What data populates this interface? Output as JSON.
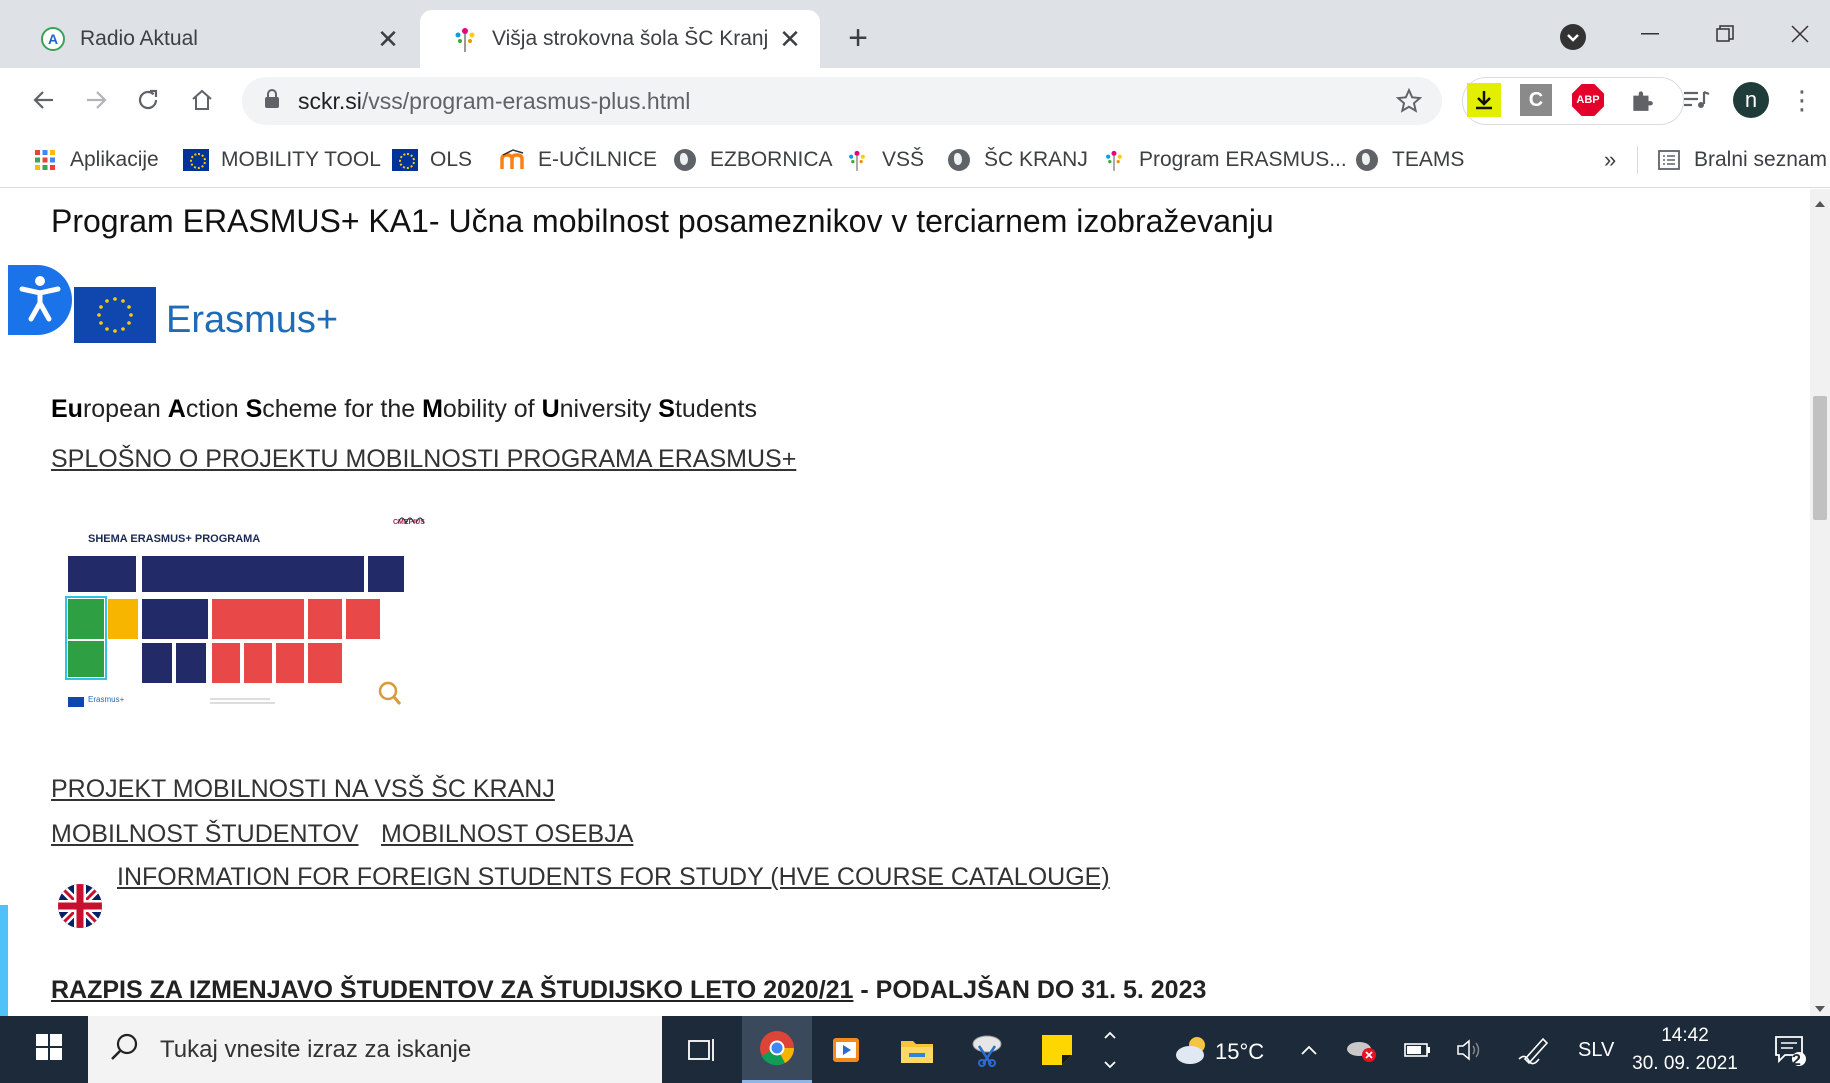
{
  "browser": {
    "tabs": [
      {
        "title": "Radio Aktual",
        "favicon": "radio-aktual-icon",
        "active": false
      },
      {
        "title": "Višja strokovna šola ŠC Kranj - ER",
        "favicon": "sckr-icon",
        "active": true
      }
    ],
    "new_tab_label": "+",
    "address_bar": {
      "domain": "sckr.si",
      "path": "/vss/program-erasmus-plus.html"
    },
    "profile_initial": "n",
    "extensions": [
      "download-icon",
      "c-extension-icon",
      "adblock-icon",
      "puzzle-icon",
      "media-control-icon"
    ],
    "adblock_label": "ABP",
    "c_ext_label": "C"
  },
  "bookmarks": {
    "items": [
      {
        "label": "Aplikacije",
        "icon": "apps-grid-icon"
      },
      {
        "label": "MOBILITY TOOL",
        "icon": "eu-flag-icon"
      },
      {
        "label": "OLS",
        "icon": "eu-flag-icon"
      },
      {
        "label": "E-UČILNICE",
        "icon": "moodle-icon"
      },
      {
        "label": "EZBORNICA",
        "icon": "globe-icon"
      },
      {
        "label": "VSŠ",
        "icon": "sckr-icon"
      },
      {
        "label": "ŠC KRANJ",
        "icon": "globe-icon"
      },
      {
        "label": "Program ERASMUS...",
        "icon": "sckr-icon"
      },
      {
        "label": "TEAMS",
        "icon": "globe-icon"
      }
    ],
    "overflow_label": "»",
    "reading_list_label": "Bralni seznam"
  },
  "page": {
    "title": "Program ERASMUS+ KA1- Učna mobilnost posameznikov v terciarnem izobraževanju",
    "logo_text": "Erasmus+",
    "acronym_parts": [
      {
        "bold": "Eu",
        "rest": "ropean "
      },
      {
        "bold": "A",
        "rest": "ction "
      },
      {
        "bold": "S",
        "rest": "cheme for the "
      },
      {
        "bold": "M",
        "rest": "obility of "
      },
      {
        "bold": "U",
        "rest": "niversity "
      },
      {
        "bold": "S",
        "rest": "tudents"
      }
    ],
    "links": {
      "general": "SPLOŠNO O PROJEKTU MOBILNOSTI PROGRAMA ERASMUS+",
      "project": "PROJEKT MOBILNOSTI NA VSŠ ŠC KRANJ",
      "students": "MOBILNOST ŠTUDENTOV",
      "staff": "MOBILNOST OSEBJA",
      "foreign": "INFORMATION FOR FOREIGN STUDENTS FOR STUDY (HVE COURSE CATALOUGE)"
    },
    "schema_title": "SHEMA ERASMUS+ PROGRAMA",
    "schema_logo_text": "CMEPIUS",
    "schema_footer_logo": "Erasmus+",
    "razpis": {
      "link": "RAZPIS ZA IZMENJAVO ŠTUDENTOV ZA ŠTUDIJSKO LETO 2020/21",
      "suffix": " - PODALJŠAN DO 31. 5. 2023"
    }
  },
  "taskbar": {
    "search_placeholder": "Tukaj vnesite izraz za iskanje",
    "weather": "15°C",
    "language": "SLV",
    "time": "14:42",
    "date": "30. 09. 2021",
    "notification_count": "2"
  }
}
